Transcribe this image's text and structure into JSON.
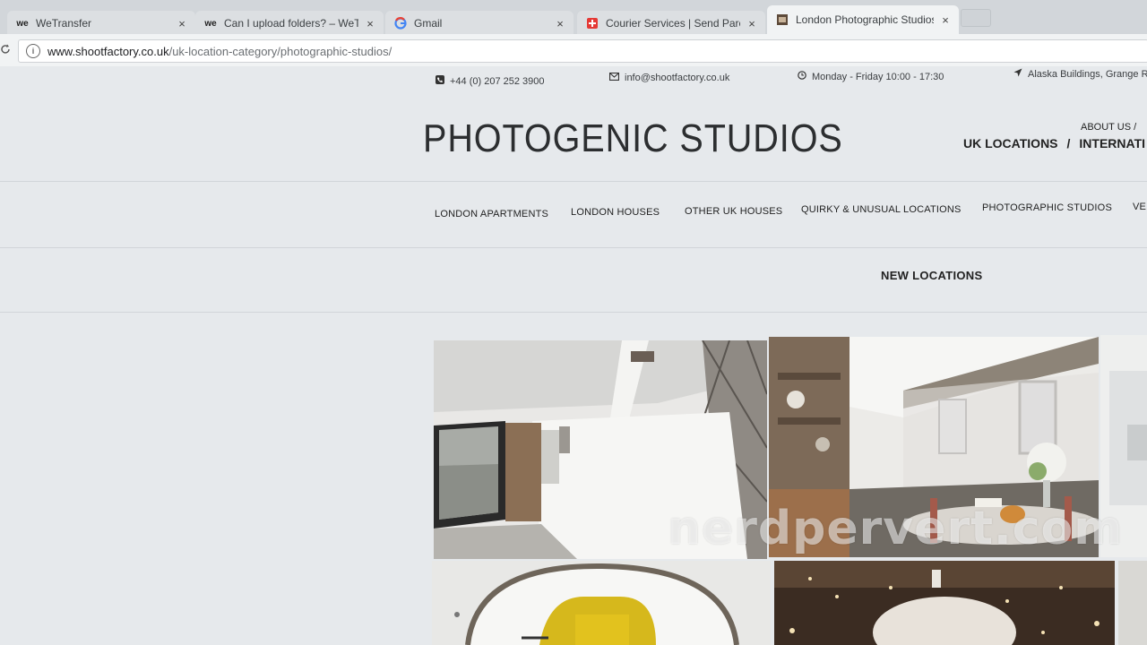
{
  "browser": {
    "tabs": [
      {
        "title": "WeTransfer",
        "favicon": "wetransfer-icon"
      },
      {
        "title": "Can I upload folders? – WeTra",
        "favicon": "wetransfer-icon"
      },
      {
        "title": "Gmail",
        "favicon": "google-icon"
      },
      {
        "title": "Courier Services | Send Parce",
        "favicon": "parcel-icon"
      },
      {
        "title": "London Photographic Studios",
        "favicon": "shootfactory-icon"
      }
    ],
    "close_glyph": "×",
    "url_domain": "www.shootfactory.co.uk",
    "url_path": "/uk-location-category/photographic-studios/"
  },
  "contact": {
    "phone": "+44 (0) 207 252 3900",
    "email": "info@shootfactory.co.uk",
    "hours": "Monday - Friday 10:00 - 17:30",
    "address": "Alaska Buildings, Grange R"
  },
  "brand": {
    "logo": "PHOTOGENIC STUDIOS",
    "about": "ABOUT US  /",
    "uk_locations": "UK LOCATIONS",
    "separator": "/",
    "international": "INTERNATI"
  },
  "nav": {
    "items": [
      "LONDON APARTMENTS",
      "LONDON HOUSES",
      "OTHER UK HOUSES",
      "QUIRKY & UNUSUAL LOCATIONS",
      "PHOTOGRAPHIC STUDIOS",
      "VE"
    ],
    "new_locations": "NEW LOCATIONS"
  },
  "watermark": "nerdpervert.com",
  "colors": {
    "accent_red": "#d9442c",
    "text_dark": "#222222"
  }
}
